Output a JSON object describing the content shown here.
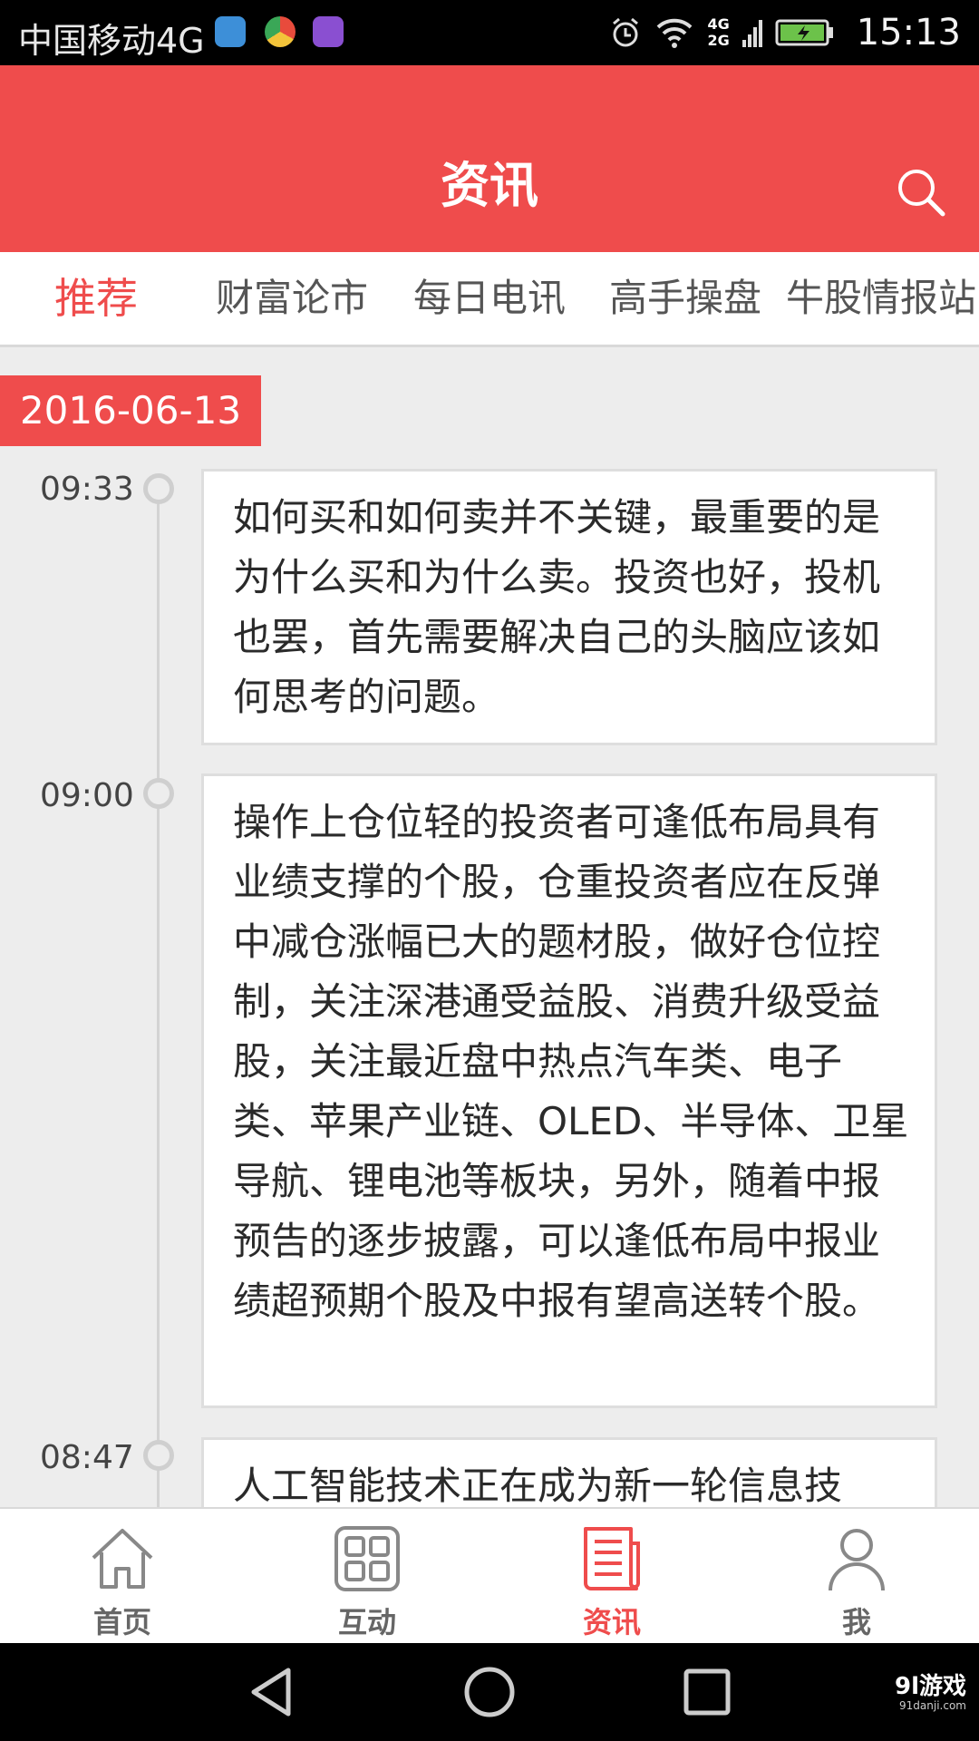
{
  "status_bar": {
    "carrier": "中国移动4G",
    "time": "15:13",
    "network_top": "4G",
    "network_bottom": "2G",
    "icons": [
      "browser-notification-icon",
      "app-notification-icon",
      "gallery-notification-icon",
      "alarm-icon",
      "wifi-icon",
      "signal-icon",
      "battery-charging-icon"
    ]
  },
  "header": {
    "title": "资讯",
    "search_icon": "search-icon",
    "background": "#ef4c4c"
  },
  "tabs": [
    {
      "label": "推荐",
      "active": true
    },
    {
      "label": "财富论市",
      "active": false
    },
    {
      "label": "每日电讯",
      "active": false
    },
    {
      "label": "高手操盘",
      "active": false
    },
    {
      "label": "牛股情报站",
      "active": false
    }
  ],
  "feed": {
    "date": "2016-06-13",
    "items": [
      {
        "time": "09:33",
        "text": "如何买和如何卖并不关键，最重要的是为什么买和为什么卖。投资也好，投机也罢，首先需要解决自己的头脑应该如何思考的问题。"
      },
      {
        "time": "09:00",
        "text": "操作上仓位轻的投资者可逢低布局具有业绩支撑的个股，仓重投资者应在反弹中减仓涨幅已大的题材股，做好仓位控制，关注深港通受益股、消费升级受益股，关注最近盘中热点汽车类、电子类、苹果产业链、OLED、半导体、卫星导航、锂电池等板块，另外，随着中报预告的逐步披露，可以逢低布局中报业绩超预期个股及中报有望高送转个股。"
      },
      {
        "time": "08:47",
        "text": "人工智能技术正在成为新一轮信息技"
      }
    ]
  },
  "bottom_nav": [
    {
      "label": "首页",
      "icon": "home-icon",
      "active": false
    },
    {
      "label": "互动",
      "icon": "grid-icon",
      "active": false
    },
    {
      "label": "资讯",
      "icon": "news-icon",
      "active": true
    },
    {
      "label": "我",
      "icon": "user-icon",
      "active": false
    }
  ],
  "system_nav": {
    "icons": [
      "back-icon",
      "home-circle-icon",
      "recents-icon"
    ],
    "watermark": "9l游戏",
    "watermark_sub": "91danji.com"
  },
  "colors": {
    "accent": "#ef4c4c",
    "background": "#ededed"
  }
}
